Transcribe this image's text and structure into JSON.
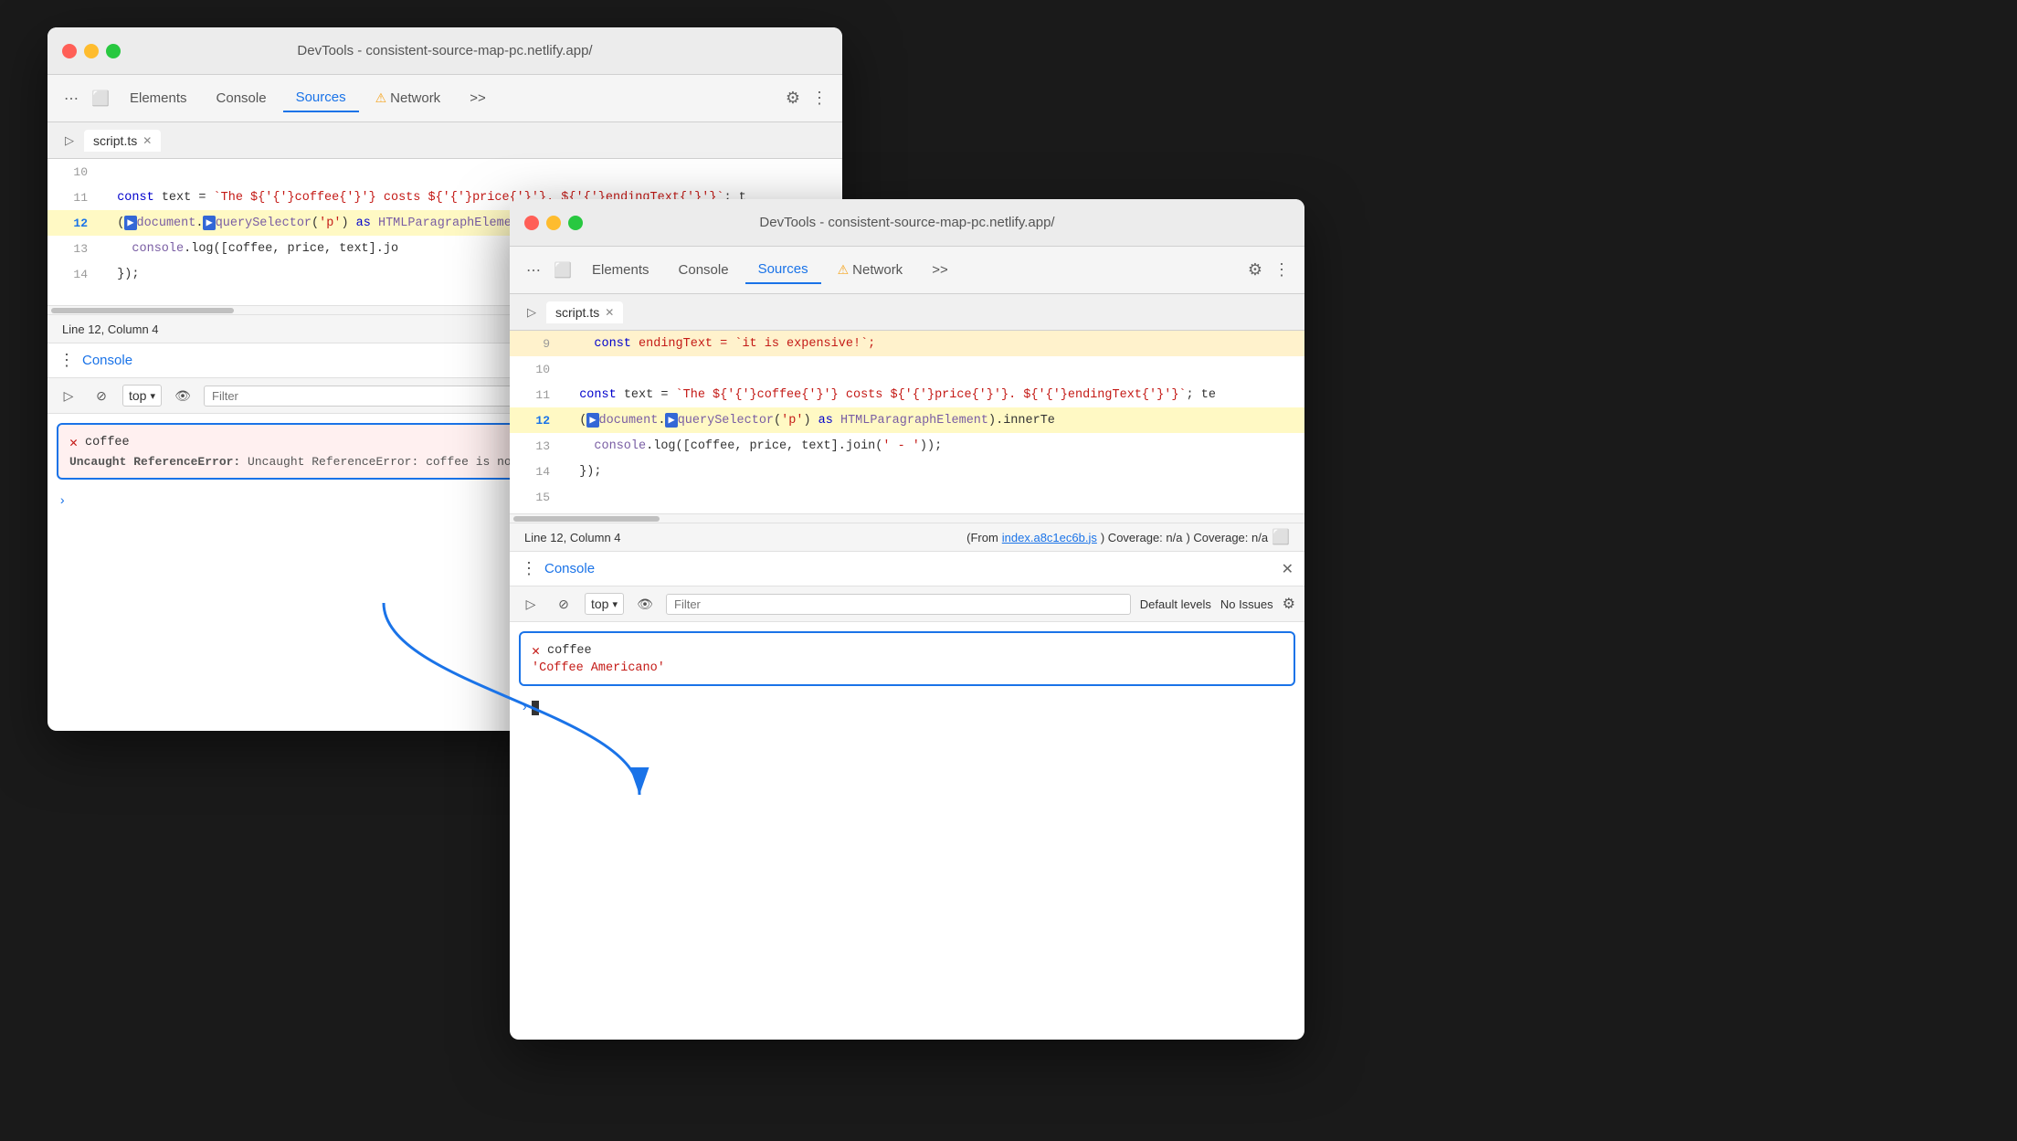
{
  "window1": {
    "title": "DevTools - consistent-source-map-pc.netlify.app/",
    "tabs": {
      "elements": "Elements",
      "console": "Console",
      "sources": "Sources",
      "network": "Network",
      "more": ">>"
    },
    "activeTab": "Sources",
    "fileTab": "script.ts",
    "code": {
      "lines": [
        {
          "num": "10",
          "content": ""
        },
        {
          "num": "11",
          "text": "  const text = `The ${coffee} costs ${price}. ${endingText}`;  t"
        },
        {
          "num": "12",
          "text": "  (document.querySelector('p') as HTMLParagraphElement).innerT",
          "highlighted": true
        },
        {
          "num": "13",
          "text": "    console.log([coffee, price, text].jo"
        },
        {
          "num": "14",
          "text": "  });"
        }
      ]
    },
    "statusBar": {
      "position": "Line 12, Column 4",
      "from": "(From index.",
      "link": "index.",
      "coverage": ""
    },
    "console": {
      "title": "Console",
      "toolbar": {
        "topLabel": "top",
        "filterPlaceholder": "Filter",
        "defaultLevels": "Def"
      },
      "errorBox": {
        "errorName": "coffee",
        "errorMessage": "Uncaught ReferenceError: coffee is not defi"
      }
    }
  },
  "window2": {
    "title": "DevTools - consistent-source-map-pc.netlify.app/",
    "tabs": {
      "elements": "Elements",
      "console": "Console",
      "sources": "Sources",
      "network": "Network",
      "more": ">>"
    },
    "activeTab": "Sources",
    "fileTab": "script.ts",
    "code": {
      "lines": [
        {
          "num": "9",
          "text": "  const endingText = `it is expensive!`;"
        },
        {
          "num": "10",
          "text": ""
        },
        {
          "num": "11",
          "text": "  const text = `The ${coffee} costs ${price}. ${endingText}`;  te"
        },
        {
          "num": "12",
          "text": "  (document.querySelector('p') as HTMLParagraphElement).innerTe",
          "highlighted": true
        },
        {
          "num": "13",
          "text": "    console.log([coffee, price, text].join(' - '));"
        },
        {
          "num": "14",
          "text": "  });"
        },
        {
          "num": "15",
          "text": ""
        }
      ]
    },
    "statusBar": {
      "position": "Line 12, Column 4",
      "from": "(From ",
      "link": "index.a8c1ec6b.js",
      "coverage": ") Coverage: n/a"
    },
    "console": {
      "title": "Console",
      "toolbar": {
        "topLabel": "top",
        "filterPlaceholder": "Filter",
        "defaultLevels": "Default levels",
        "noIssues": "No Issues"
      },
      "successBox": {
        "varName": "coffee",
        "value": "'Coffee Americano'"
      }
    }
  },
  "arrow": {
    "label": "blue connector arrow"
  }
}
